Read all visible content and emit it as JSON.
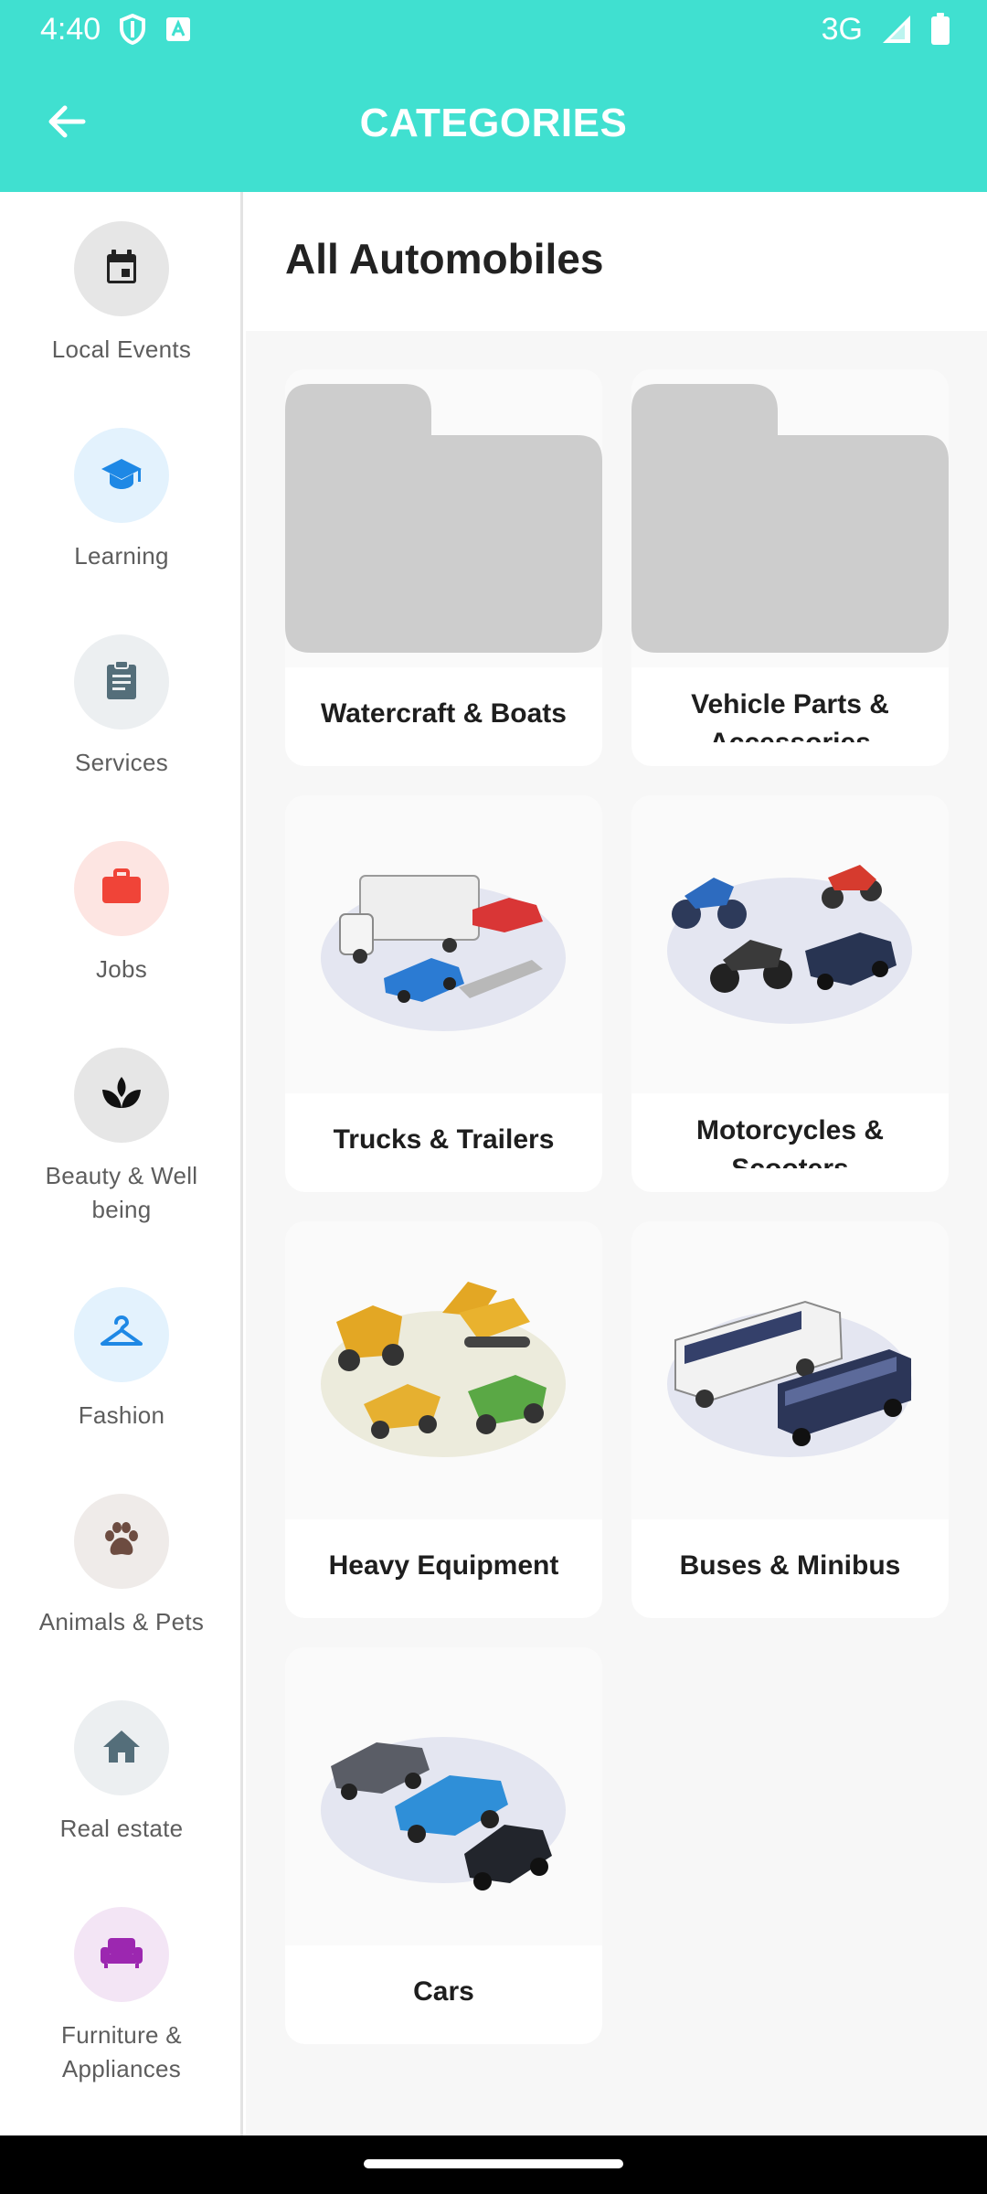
{
  "status_bar": {
    "time": "4:40",
    "network": "3G",
    "icons": [
      "shield-icon",
      "a-box-icon",
      "signal-icon",
      "battery-icon"
    ]
  },
  "app_bar": {
    "title": "CATEGORIES",
    "back_icon": "arrow-left-icon"
  },
  "sidebar": {
    "items": [
      {
        "label": "Local Events",
        "icon": "calendar-icon",
        "bg": "#E6E6E6",
        "color": "#222222"
      },
      {
        "label": "Learning",
        "icon": "graduation-cap-icon",
        "bg": "#E3F2FD",
        "color": "#1E88E5"
      },
      {
        "label": "Services",
        "icon": "clipboard-icon",
        "bg": "#ECEFF1",
        "color": "#546E7A"
      },
      {
        "label": "Jobs",
        "icon": "briefcase-icon",
        "bg": "#FDE5E2",
        "color": "#F04438"
      },
      {
        "label": "Beauty & Well being",
        "icon": "lotus-icon",
        "bg": "#E6E6E6",
        "color": "#111111"
      },
      {
        "label": "Fashion",
        "icon": "hanger-icon",
        "bg": "#E3F2FD",
        "color": "#1E88E5"
      },
      {
        "label": "Animals & Pets",
        "icon": "paw-icon",
        "bg": "#EFEBE9",
        "color": "#6D4C41"
      },
      {
        "label": "Real estate",
        "icon": "house-icon",
        "bg": "#ECEFF1",
        "color": "#546E7A"
      },
      {
        "label": "Furniture & Appliances",
        "icon": "sofa-icon",
        "bg": "#F3E5F5",
        "color": "#9C27B0"
      }
    ]
  },
  "content": {
    "title": "All Automobiles",
    "cards": [
      {
        "label": "Watercraft & Boats",
        "image": "folder-placeholder-icon"
      },
      {
        "label": "Vehicle Parts & Accessories",
        "image": "folder-placeholder-icon"
      },
      {
        "label": "Trucks & Trailers",
        "image": "trucks-trailers-illustration"
      },
      {
        "label": "Motorcycles & Scooters",
        "image": "motorcycles-scooters-illustration"
      },
      {
        "label": "Heavy Equipment",
        "image": "heavy-equipment-illustration"
      },
      {
        "label": "Buses & Minibus",
        "image": "buses-illustration"
      },
      {
        "label": "Cars",
        "image": "cars-illustration"
      }
    ]
  },
  "colors": {
    "accent": "#40E0D0"
  }
}
